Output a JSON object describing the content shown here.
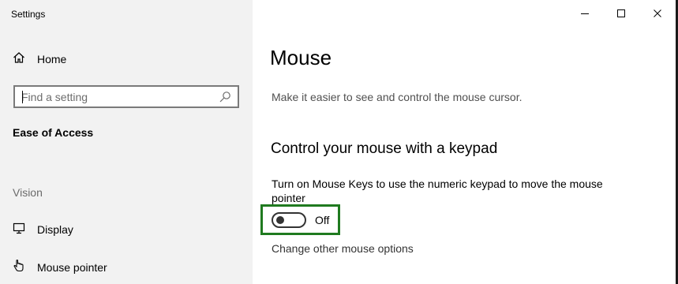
{
  "window": {
    "title": "Settings"
  },
  "sidebar": {
    "home_label": "Home",
    "search": {
      "placeholder": "Find a setting",
      "value": ""
    },
    "section_title": "Ease of Access",
    "group_label": "Vision",
    "items": [
      {
        "label": "Display",
        "icon": "display-icon"
      },
      {
        "label": "Mouse pointer",
        "icon": "mouse-pointer-icon"
      }
    ]
  },
  "main": {
    "title": "Mouse",
    "description": "Make it easier to see and control the mouse cursor.",
    "section_heading": "Control your mouse with a keypad",
    "mouse_keys": {
      "description": "Turn on Mouse Keys to use the numeric keypad to move the mouse pointer",
      "state": "Off",
      "enabled": false
    },
    "link_label": "Change other mouse options"
  },
  "colors": {
    "sidebar_bg": "#f2f2f2",
    "highlight": "#1f7a1f"
  }
}
